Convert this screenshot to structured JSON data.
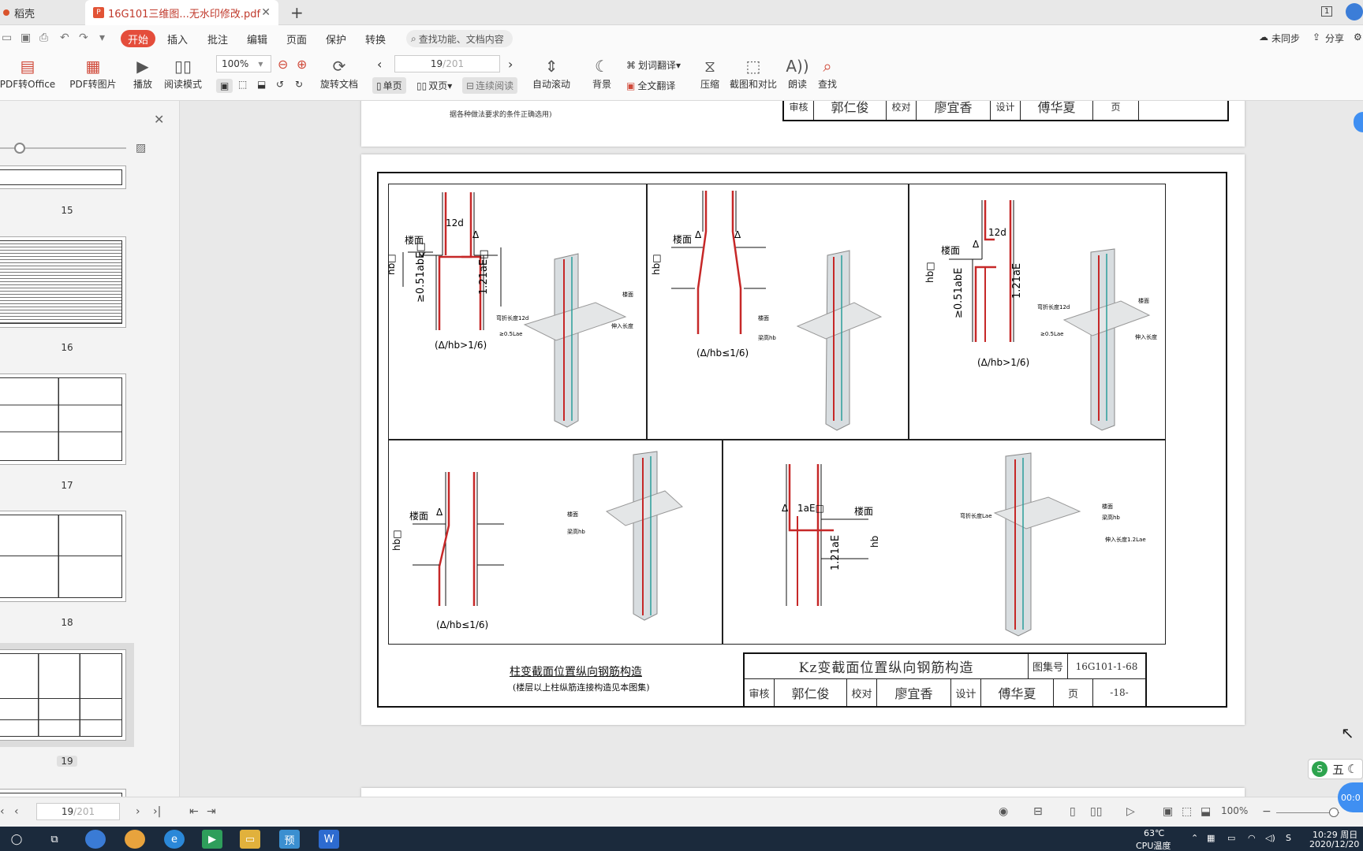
{
  "titlebar": {
    "home_tab": "稻壳",
    "doc_tab": "16G101三维图...无水印修改.pdf",
    "pdf_badge": "P",
    "close": "✕",
    "new_tab": "+",
    "window_number": "1"
  },
  "menu": {
    "start": "开始",
    "items": [
      "插入",
      "批注",
      "编辑",
      "页面",
      "保护",
      "转换"
    ],
    "search": "查找功能、文档内容",
    "sync": "未同步",
    "share": "分享"
  },
  "toolbar": {
    "pdf_to_office": "PDF转Office",
    "pdf_to_image": "PDF转图片",
    "play": "播放",
    "read_mode": "阅读模式",
    "zoom": "100%",
    "page_current": "19",
    "page_total": "/201",
    "rotate": "旋转文档",
    "single_page": "单页",
    "double_page": "双页",
    "continuous": "连续阅读",
    "auto_scroll": "自动滚动",
    "background": "背景",
    "word_translate": "划词翻译",
    "full_translate": "全文翻译",
    "compress": "压缩",
    "screenshot_compare": "截图和对比",
    "read_aloud": "朗读",
    "find": "查找"
  },
  "sidebar": {
    "thumbnails": [
      {
        "num": "15"
      },
      {
        "num": "16"
      },
      {
        "num": "17"
      },
      {
        "num": "18"
      },
      {
        "num": "19",
        "selected": true
      }
    ]
  },
  "document": {
    "prev_page_note": "据各种做法要求的条件正确选用)",
    "prev_title_row": {
      "review_label": "审核",
      "reviewer": "郭仁俊",
      "check_label": "校对",
      "checker": "廖宜香",
      "design_label": "设计",
      "designer": "傅华夏",
      "page_label": "页",
      "page_value": ""
    },
    "labels": {
      "floor": "楼面",
      "d12": "12d",
      "delta": "Δ",
      "hb": "hb",
      "anchor_051": "≥0.51abE",
      "anchor_121": "1.21aE",
      "cond_gt": "(Δ/hb>1/6)",
      "cond_le": "(Δ/hb≤1/6)",
      "bend_12d": "弯折长度12d",
      "lap_05": "≥0.5Lae",
      "insert_12": "伸入长度1.2Lae",
      "beam_height": "梁高hb",
      "lae": "1aE",
      "bend_lae": "弯折长度Lae",
      "insert_12b": "伸入长度1.2Lae"
    },
    "caption_main": "柱变截面位置纵向钢筋构造",
    "caption_sub": "(楼层以上柱纵筋连接构造见本图集)",
    "title_block": {
      "title": "Kz变截面位置纵向钢筋构造",
      "atlas_label": "图集号",
      "atlas_value": "16G101-1-68",
      "review_label": "审核",
      "reviewer": "郭仁俊",
      "check_label": "校对",
      "checker": "廖宜香",
      "design_label": "设计",
      "designer": "傅华夏",
      "page_label": "页",
      "page_value": "-18-"
    }
  },
  "statusbar": {
    "page_current": "19",
    "page_total": "/201",
    "zoom": "100%"
  },
  "taskbar": {
    "temp": "63℃",
    "temp_label": "CPU温度",
    "time": "10:29 周日",
    "date": "2020/12/20"
  },
  "ime": {
    "label": "五",
    "logo": "S"
  },
  "timer": "00:0",
  "colors": {
    "accent": "#e44d3b",
    "rebar_red": "#c62828",
    "rebar_teal": "#2a9d9a"
  }
}
